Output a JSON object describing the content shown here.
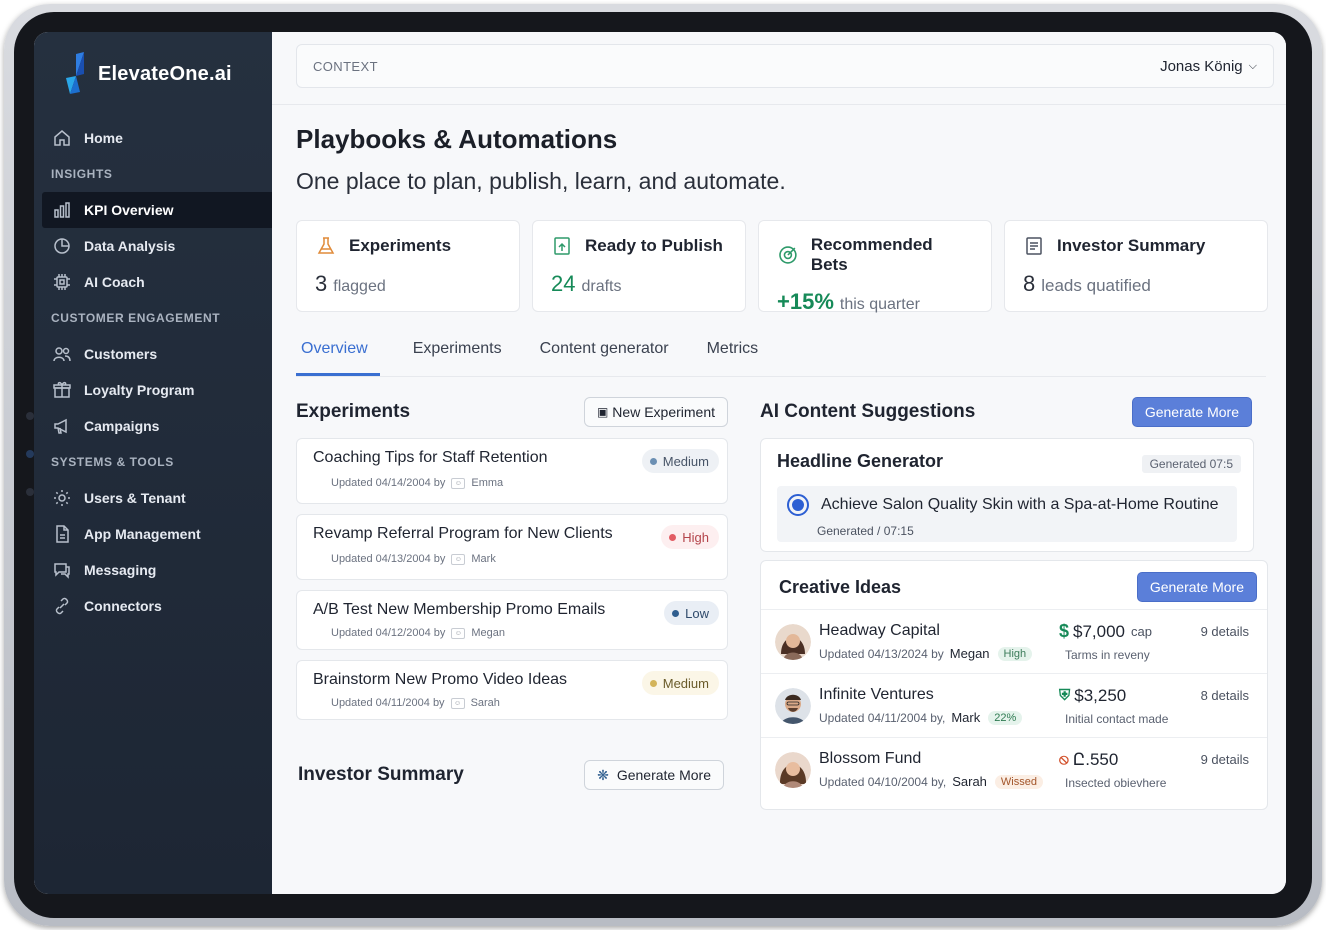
{
  "brand": {
    "name": "ElevateOne",
    "suffix": ".ai"
  },
  "sidebar": {
    "home": "Home",
    "sections": [
      {
        "title": "INSIGHTS",
        "items": [
          "KPI Overview",
          "Data Analysis",
          "AI Coach"
        ]
      },
      {
        "title": "CUSTOMER ENGAGEMENT",
        "items": [
          "Customers",
          "Loyalty Program",
          "Campaigns"
        ]
      },
      {
        "title": "SYSTEMS & TOOLS",
        "items": [
          "Users & Tenant",
          "App Management",
          "Messaging",
          "Connectors"
        ]
      }
    ],
    "active": "KPI Overview"
  },
  "topbar": {
    "context": "CONTEXT",
    "user": "Jonas König"
  },
  "page": {
    "title": "Playbooks & Automations",
    "subtitle": "One place to plan, publish, learn, and automate."
  },
  "kpis": [
    {
      "title": "Experiments",
      "value": "3",
      "unit": "flagged",
      "icon": "flask-icon"
    },
    {
      "title": "Ready to Publish",
      "value": "24",
      "unit": "drafts",
      "icon": "publish-icon"
    },
    {
      "title": "Recommended Bets",
      "value": "+15%",
      "unit": "this quarter",
      "icon": "target-icon"
    },
    {
      "title": "Investor Summary",
      "value": "8",
      "unit": "leads quatified",
      "icon": "document-icon"
    }
  ],
  "tabs": [
    "Overview",
    "Experiments",
    "Content generator",
    "Metrics"
  ],
  "experiments": {
    "title": "Experiments",
    "new_button": "New Experiment",
    "items": [
      {
        "title": "Coaching Tips for Staff Retention",
        "updated": "Updated 04/14/2004 by",
        "who": "Emma",
        "priority": "Medium"
      },
      {
        "title": "Revamp Referral Program for New Clients",
        "updated": "Updated 04/13/2004 by",
        "who": "Mark",
        "priority": "High"
      },
      {
        "title": "A/B Test New Membership Promo Emails",
        "updated": "Updated 04/12/2004 by",
        "who": "Megan",
        "priority": "Low"
      },
      {
        "title": "Brainstorm New Promo Video Ideas",
        "updated": "Updated 04/11/2004 by",
        "who": "Sarah",
        "priority": "Medium"
      }
    ]
  },
  "investor": {
    "title": "Investor Summary",
    "button": "Generate More"
  },
  "ai": {
    "title": "AI Content Suggestions",
    "button": "Generate More",
    "headline": {
      "title": "Headline Generator",
      "tag": "Generated 07:5",
      "text": "Achieve Salon Quality Skin with a Spa-at-Home Routine",
      "time_label": "Generated",
      "time": "07:15"
    },
    "ideas": {
      "title": "Creative Ideas",
      "button": "Generate More",
      "items": [
        {
          "name": "Headway Capital",
          "updated": "Updated 04/13/2024 by",
          "who": "Megan",
          "pill": "High",
          "amount": "$7,000",
          "cap": "cap",
          "sub": "Tarms in reveny",
          "details": "9 details"
        },
        {
          "name": "Infinite Ventures",
          "updated": "Updated 04/11/2004 by,",
          "who": "Mark",
          "pill": "22%",
          "amount": "$3,250",
          "cap": "",
          "sub": "Initial contact made",
          "details": "8 details"
        },
        {
          "name": "Blossom Fund",
          "updated": "Updated 04/10/2004 by,",
          "who": "Sarah",
          "pill": "Wissed",
          "amount": "Ը.550",
          "cap": "",
          "sub": "Insected obievhere",
          "details": "9 details"
        }
      ]
    }
  },
  "colors": {
    "accent": "#3a6fd1",
    "primary_button": "#5b7fd9",
    "sidebar": "#25303f",
    "positive": "#168a58"
  }
}
